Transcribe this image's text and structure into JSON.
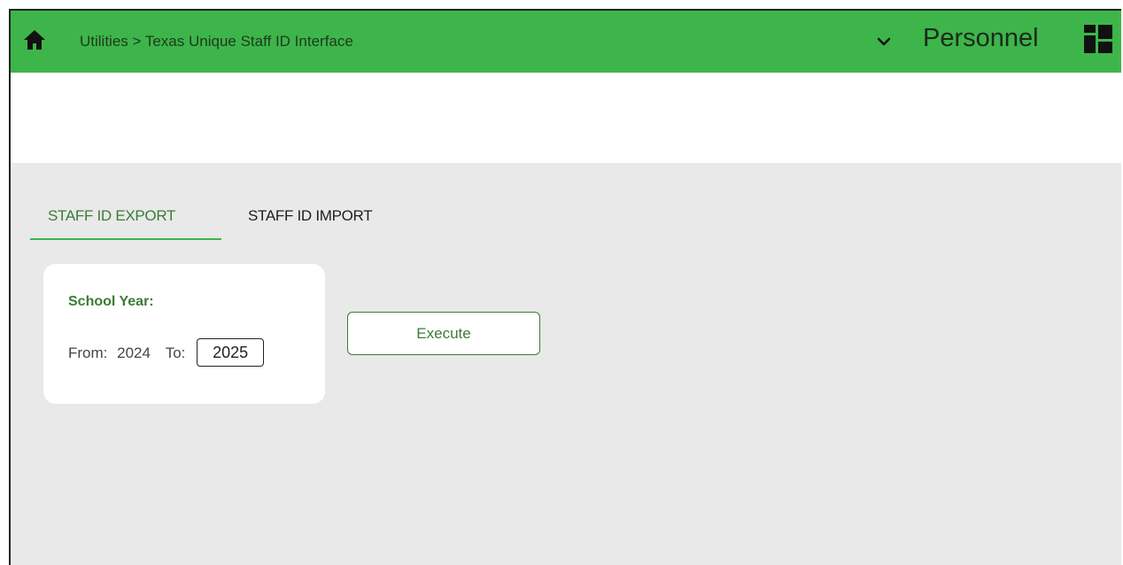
{
  "header": {
    "breadcrumb": "Utilities > Texas Unique Staff ID Interface",
    "module": "Personnel",
    "icons": {
      "home": "home-icon",
      "dropdown": "chevron-down-icon",
      "apps": "grid-icon"
    },
    "color": "#3db54a"
  },
  "tabs": [
    {
      "label": "STAFF ID EXPORT",
      "active": true
    },
    {
      "label": "STAFF ID IMPORT",
      "active": false
    }
  ],
  "school_year": {
    "title": "School Year:",
    "from_label": "From:",
    "from_value": "2024",
    "to_label": "To:",
    "to_value": "2025"
  },
  "actions": {
    "execute_label": "Execute"
  },
  "colors": {
    "accent": "#3db54a",
    "accent_text": "#3b7d34",
    "background": "#e9e9e9"
  }
}
